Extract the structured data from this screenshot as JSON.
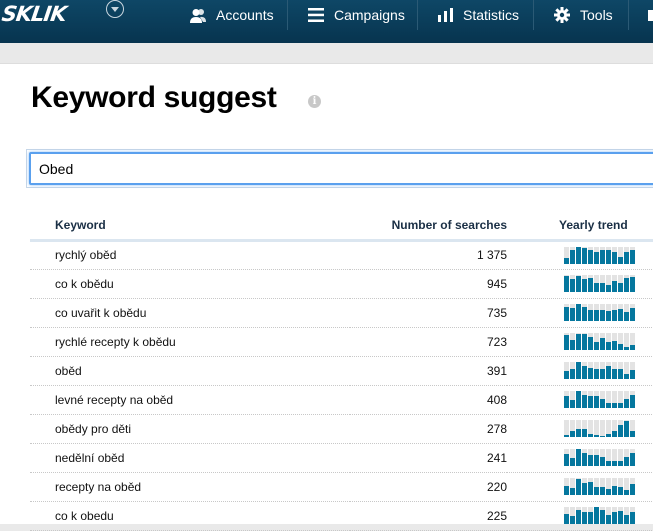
{
  "app": {
    "logo": "SKLIK"
  },
  "nav": {
    "items": [
      {
        "label": "Accounts",
        "icon": "users-icon"
      },
      {
        "label": "Campaigns",
        "icon": "menu-icon"
      },
      {
        "label": "Statistics",
        "icon": "bar-chart-icon"
      },
      {
        "label": "Tools",
        "icon": "gear-icon"
      }
    ]
  },
  "page": {
    "title": "Keyword suggest",
    "info_icon": "i"
  },
  "search": {
    "value": "Obed"
  },
  "table": {
    "headers": {
      "keyword": "Keyword",
      "searches": "Number of searches",
      "trend": "Yearly trend"
    },
    "rows": [
      {
        "keyword": "rychlý oběd",
        "searches": "1 375",
        "trend": [
          0.35,
          0.8,
          1.0,
          0.92,
          0.85,
          0.72,
          0.85,
          0.8,
          0.72,
          0.4,
          0.72,
          0.85
        ]
      },
      {
        "keyword": "co k obědu",
        "searches": "945",
        "trend": [
          0.95,
          0.78,
          0.95,
          0.78,
          0.82,
          0.55,
          0.55,
          0.42,
          0.62,
          0.55,
          0.82,
          0.88
        ]
      },
      {
        "keyword": "co uvařit k obědu",
        "searches": "735",
        "trend": [
          0.85,
          0.78,
          1.0,
          0.85,
          0.65,
          0.65,
          0.65,
          0.58,
          0.65,
          0.7,
          0.52,
          0.78
        ]
      },
      {
        "keyword": "rychlé recepty k obědu",
        "searches": "723",
        "trend": [
          0.88,
          0.58,
          0.95,
          0.95,
          0.78,
          0.45,
          0.7,
          0.45,
          0.5,
          0.38,
          0.2,
          0.32
        ]
      },
      {
        "keyword": "oběd",
        "searches": "391",
        "trend": [
          0.45,
          0.58,
          1.0,
          0.78,
          0.65,
          0.58,
          0.58,
          0.78,
          0.58,
          0.58,
          0.32,
          0.52
        ]
      },
      {
        "keyword": "levné recepty na oběd",
        "searches": "408",
        "trend": [
          0.68,
          0.45,
          1.0,
          0.78,
          0.68,
          0.68,
          0.5,
          0.3,
          0.3,
          0.3,
          0.5,
          0.75
        ]
      },
      {
        "keyword": "obědy pro děti",
        "searches": "278",
        "trend": [
          0.12,
          0.38,
          0.45,
          0.45,
          0.2,
          0.12,
          0.06,
          0.2,
          0.38,
          0.68,
          0.95,
          0.38
        ]
      },
      {
        "keyword": "nedělní oběd",
        "searches": "241",
        "trend": [
          0.68,
          0.45,
          1.0,
          0.78,
          0.65,
          0.65,
          0.5,
          0.3,
          0.3,
          0.3,
          0.5,
          0.75
        ]
      },
      {
        "keyword": "recepty na oběd",
        "searches": "220",
        "trend": [
          0.55,
          0.42,
          0.95,
          0.68,
          0.75,
          0.48,
          0.45,
          0.38,
          0.55,
          0.45,
          0.32,
          0.62
        ]
      },
      {
        "keyword": "co k obedu",
        "searches": "225",
        "trend": [
          0.6,
          0.48,
          0.85,
          0.68,
          0.68,
          1.0,
          0.85,
          0.55,
          0.68,
          0.75,
          0.55,
          0.68
        ]
      }
    ]
  }
}
